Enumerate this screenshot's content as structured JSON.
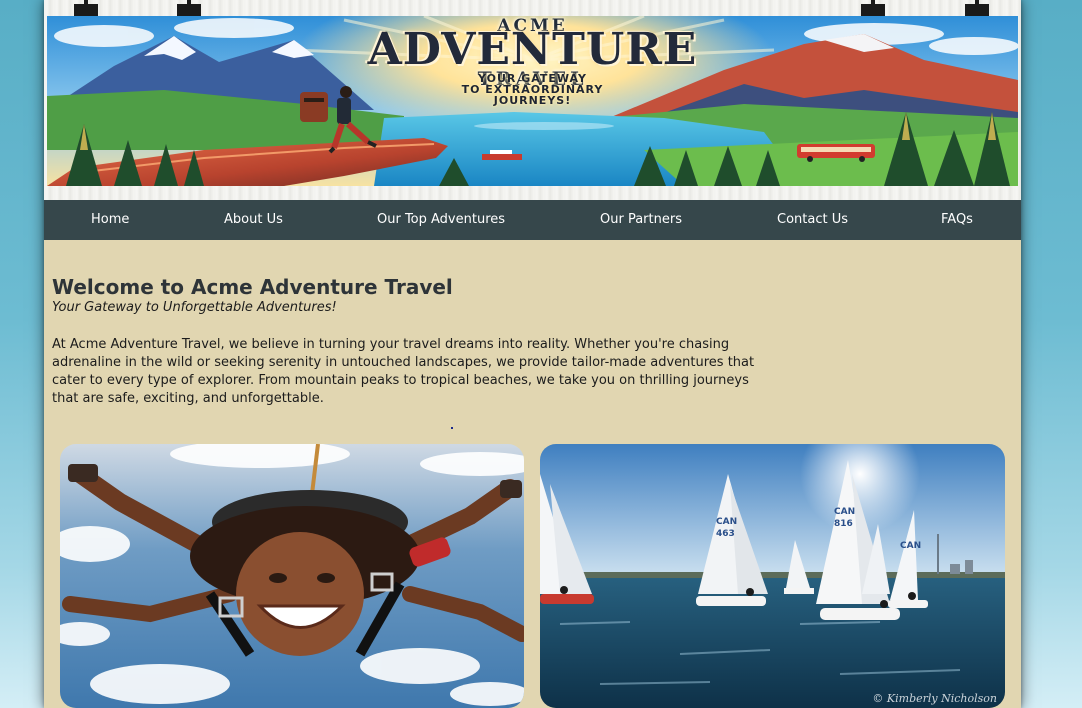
{
  "banner": {
    "brand_small": "ACME",
    "brand_big": "ADVENTURE",
    "brand_travel": "TRAVEL",
    "tagline_line1": "YOUR GATEWAY",
    "tagline_line2": "TO EXTRAORDINARY",
    "tagline_line3": "JOURNEYS!"
  },
  "nav": {
    "items": [
      {
        "label": "Home"
      },
      {
        "label": "About Us"
      },
      {
        "label": "Our Top Adventures"
      },
      {
        "label": "Our Partners"
      },
      {
        "label": "Contact Us"
      },
      {
        "label": "FAQs"
      }
    ]
  },
  "main": {
    "heading": "Welcome to Acme Adventure Travel",
    "subheading": "Your Gateway to Unforgettable Adventures!",
    "intro": "At Acme Adventure Travel, we believe in turning your travel dreams into reality. Whether you're chasing adrenaline in the wild or seeking serenity in untouched landscapes, we provide tailor-made adventures that cater to every type of explorer. From mountain peaks to tropical beaches, we take you on thrilling journeys that are safe, exciting, and unforgettable."
  },
  "photos": {
    "right_credit": "© Kimberly Nicholson"
  },
  "colors": {
    "page_background": "#e1d6b1",
    "nav_background": "#36474b",
    "nav_text": "#ffffff",
    "body_background": "#6dbcd2",
    "heading_text": "#2e3438"
  }
}
